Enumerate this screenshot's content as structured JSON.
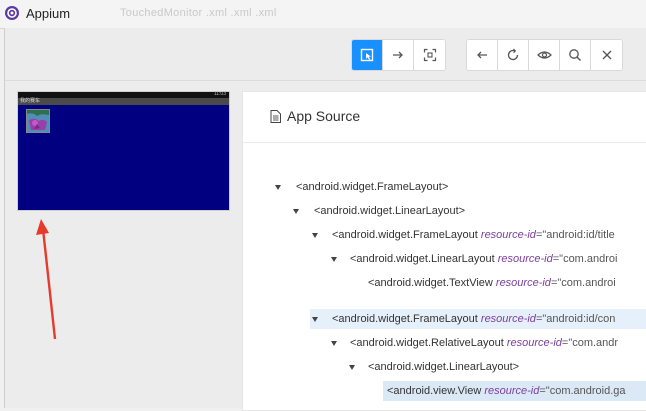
{
  "window": {
    "title": "Appium",
    "ghost_text": "TouchedMonitor          .xml          .xml          .xml",
    "accent": "#1890ff"
  },
  "toolbar": {
    "left_group": [
      {
        "name": "select-element-button",
        "icon": "select-element-icon",
        "active": true
      },
      {
        "name": "swipe-button",
        "icon": "arrow-right-icon",
        "active": false
      },
      {
        "name": "tap-coordinates-button",
        "icon": "crosshair-icon",
        "active": false
      }
    ],
    "right_group": [
      {
        "name": "back-button",
        "icon": "arrow-left-icon"
      },
      {
        "name": "refresh-button",
        "icon": "refresh-icon"
      },
      {
        "name": "toggle-visibility-button",
        "icon": "eye-icon"
      },
      {
        "name": "search-button",
        "icon": "search-icon"
      },
      {
        "name": "quit-button",
        "icon": "close-icon"
      }
    ]
  },
  "device": {
    "status_time": "11:03",
    "title_text": "我的赛车",
    "screen_color": "#000080"
  },
  "source": {
    "title": "App Source",
    "nodes": [
      {
        "tag": "<android.widget.FrameLayout>",
        "attr": "",
        "val": ""
      },
      {
        "tag": "<android.widget.LinearLayout>",
        "attr": "",
        "val": ""
      },
      {
        "tag": "<android.widget.FrameLayout ",
        "attr": "resource-id",
        "val": "=\"android:id/title"
      },
      {
        "tag": "<android.widget.LinearLayout ",
        "attr": "resource-id",
        "val": "=\"com.androi"
      },
      {
        "tag": "<android.widget.TextView ",
        "attr": "resource-id",
        "val": "=\"com.androi"
      },
      {
        "tag": "<android.widget.FrameLayout ",
        "attr": "resource-id",
        "val": "=\"android:id/con"
      },
      {
        "tag": "<android.widget.RelativeLayout ",
        "attr": "resource-id",
        "val": "=\"com.andr"
      },
      {
        "tag": "<android.widget.LinearLayout>",
        "attr": "",
        "val": ""
      },
      {
        "tag": "<android.view.View ",
        "attr": "resource-id",
        "val": "=\"com.android.ga"
      }
    ]
  }
}
